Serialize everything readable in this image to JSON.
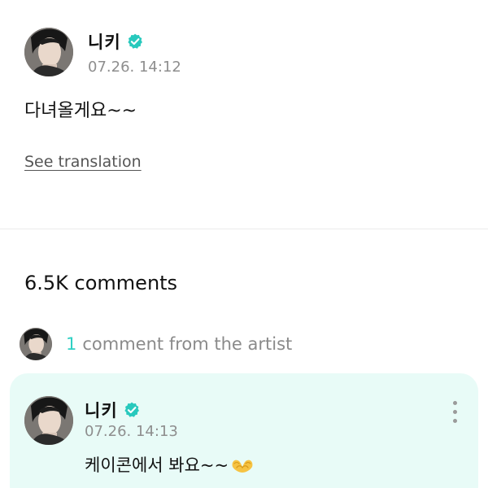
{
  "post": {
    "author_name": "니키",
    "timestamp": "07.26. 14:12",
    "body": "다녀올게요~~",
    "see_translation": "See translation"
  },
  "comments": {
    "count_label": "6.5K comments",
    "artist_comment_count": "1",
    "artist_comment_label": "comment from the artist"
  },
  "artist_comment": {
    "author_name": "니키",
    "timestamp": "07.26. 14:13",
    "text": "케이콘에서 봐요~~",
    "emoji": "heart-hands-icon"
  },
  "colors": {
    "accent": "#2fd0c4",
    "card_background": "#e8fbf7",
    "muted_text": "#8e8e8e",
    "verified": "#28c9bd"
  }
}
